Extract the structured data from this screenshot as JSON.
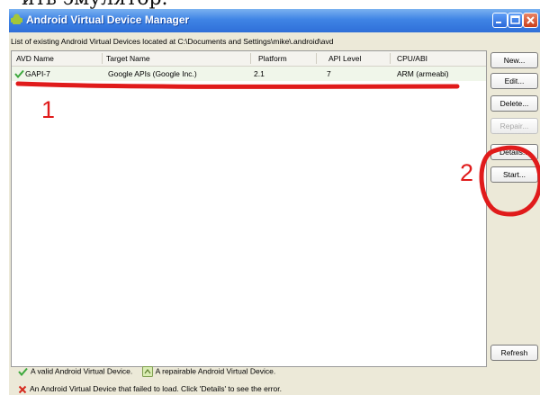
{
  "caption_crop": "ить эмулятор.",
  "window": {
    "title": "Android Virtual Device Manager"
  },
  "header_label": "List of existing Android Virtual Devices located at C:\\Documents and Settings\\mike\\.android\\avd",
  "columns": [
    "AVD Name",
    "Target Name",
    "Platform",
    "API Level",
    "CPU/ABI"
  ],
  "rows": [
    {
      "avd_name": "GAPI-7",
      "target_name": "Google APIs (Google Inc.)",
      "platform": "2.1",
      "api_level": "7",
      "cpu_abi": "ARM (armeabi)",
      "status_icon": "valid-check-icon"
    }
  ],
  "buttons": {
    "new": "New...",
    "edit": "Edit...",
    "delete": "Delete...",
    "repair": "Repair...",
    "details": "Details...",
    "start": "Start...",
    "refresh": "Refresh"
  },
  "legend": {
    "valid": "A valid Android Virtual Device.",
    "repairable": "A repairable Android Virtual Device.",
    "failed": "An Android Virtual Device that failed to load. Click 'Details' to see the error."
  },
  "annotations": {
    "marker_1": "1",
    "marker_2": "2"
  },
  "colors": {
    "annotation_red": "#e01b1b",
    "titlebar_blue": "#2f6fd8",
    "window_bg": "#ece9d8"
  }
}
